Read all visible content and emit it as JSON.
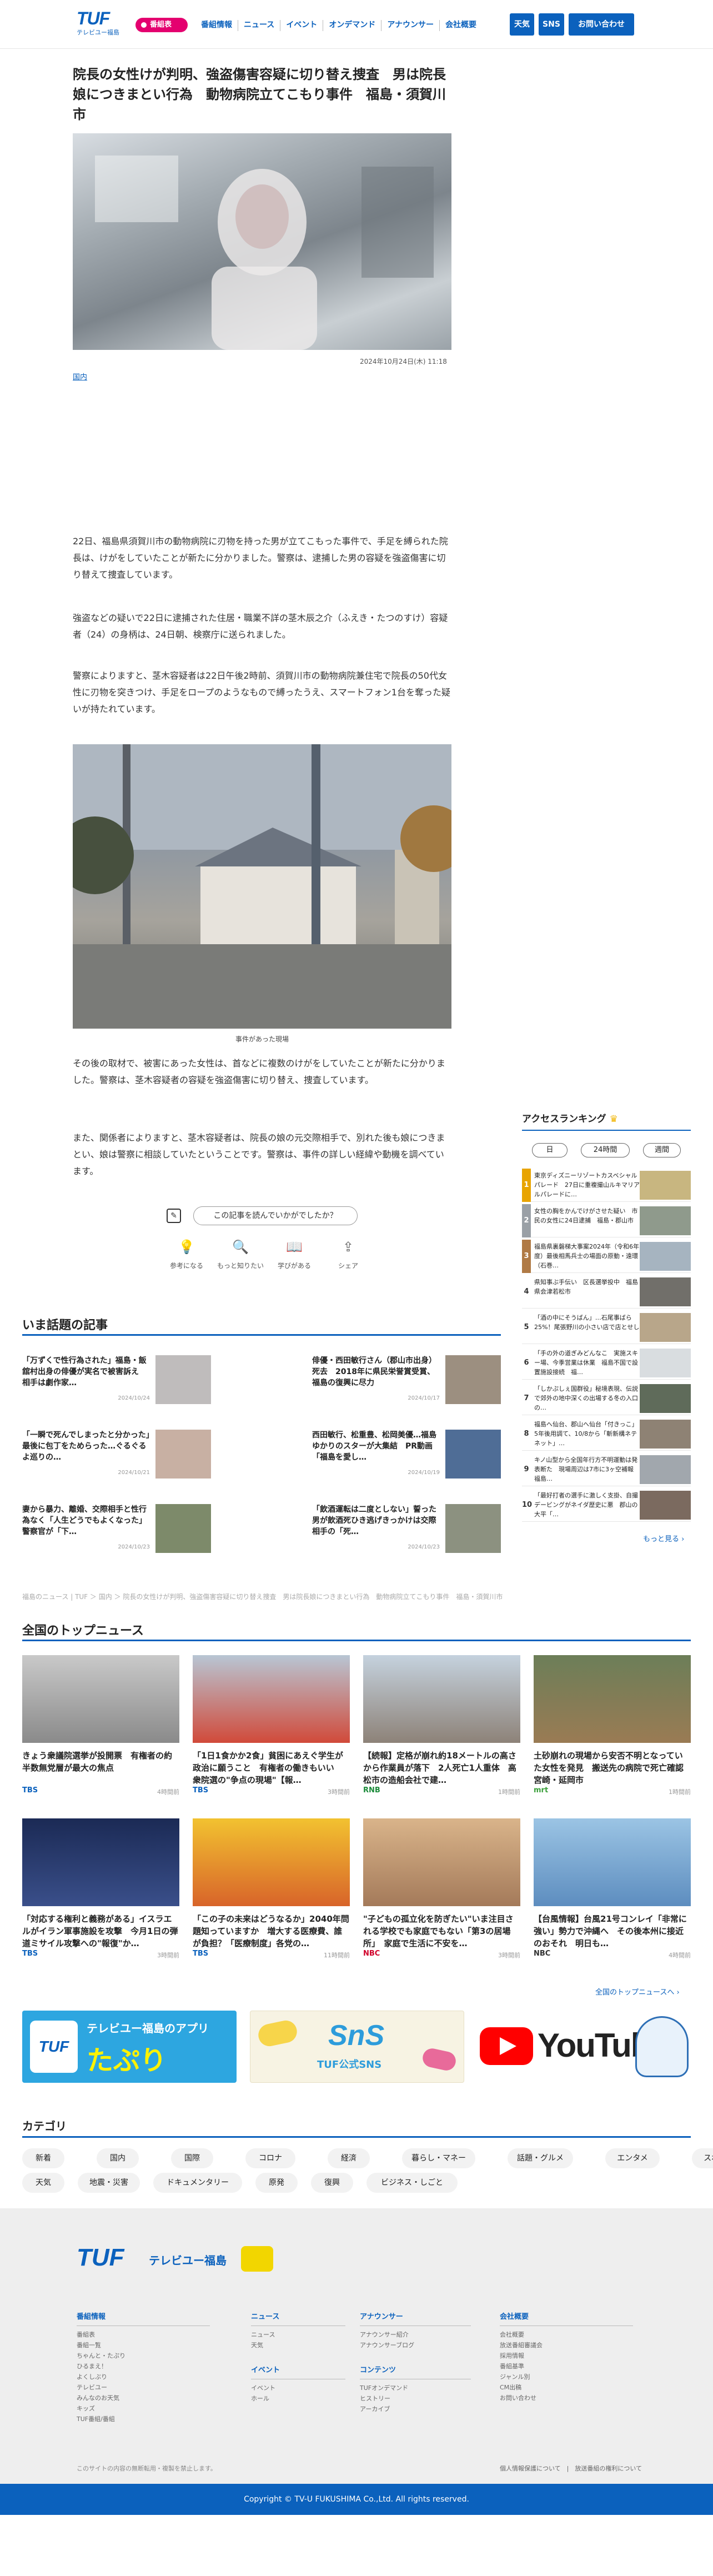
{
  "header": {
    "logo_text": "TUF",
    "logo_sub": "テレビユー福島",
    "bangumi_label": "番組表",
    "nav": [
      "番組情報",
      "ニュース",
      "イベント",
      "オンデマンド",
      "アナウンサー",
      "会社概要"
    ],
    "weather_label": "天気",
    "sns_label": "SNS",
    "contact_label": "お問い合わせ"
  },
  "article": {
    "title": "院長の女性けが判明、強盗傷害容疑に切り替え捜査　男は院長娘につきまとい行為　動物病院立てこもり事件　福島・須賀川市",
    "date": "2024年10月24日(木) 11:18",
    "category": "国内",
    "paragraphs": [
      "22日、福島県須賀川市の動物病院に刃物を持った男が立てこもった事件で、手足を縛られた院長は、けがをしていたことが新たに分かりました。警察は、逮捕した男の容疑を強盗傷害に切り替えて捜査しています。",
      "強盗などの疑いで22日に逮捕された住居・職業不詳の茎木辰之介（ふえき・たつのすけ）容疑者（24）の身柄は、24日朝、検察庁に送られました。",
      "警察によりますと、茎木容疑者は22日午後2時前、須賀川市の動物病院兼住宅で院長の50代女性に刃物を突きつけ、手足をロープのようなもので縛ったうえ、スマートフォン1台を奪った疑いが持たれています。",
      "その後の取材で、被害にあった女性は、首などに複数のけがをしていたことが新たに分かりました。警察は、茎木容疑者の容疑を強盗傷害に切り替え、捜査しています。",
      "また、関係者によりますと、茎木容疑者は、院長の娘の元交際相手で、別れた後も娘につきまとい、娘は警察に相談していたということです。警察は、事件の詳しい経緯や動機を調べています。"
    ],
    "photo_caption": "事件があった現場",
    "ask_label": "この記事を読んでいかがでしたか？",
    "reactions": [
      "参考になる",
      "もっと知りたい",
      "学びがある",
      "シェア"
    ]
  },
  "topics": {
    "title": "いま話題の記事",
    "items": [
      {
        "title": "「万ずくで性行為された」福島・飯舘村出身の俳優が実名で被害訴え　相手は劇作家…",
        "date": "2024/10/24"
      },
      {
        "title": "俳優・西田敏行さん（郡山市出身）死去　2018年に県民栄誉賞受賞、福島の復興に尽力",
        "date": "2024/10/17"
      },
      {
        "title": "「一瞬で死んでしまったと分かった」最後に包丁をためらった…ぐるぐるよ巡りの…",
        "date": "2024/10/21"
      },
      {
        "title": "西田敏行、松重豊、松岡美優…福島ゆかりのスターが大集結　PR動画「福島を愛し…",
        "date": "2024/10/19"
      },
      {
        "title": "妻から暴力、離婚、交際相手と性行為なく「人生どうでもよくなった」警察官が「下…",
        "date": "2024/10/23"
      },
      {
        "title": "「飲酒運転は二度としない」誓った男が飲酒死ひき逃げきっかけは交際相手の「死…",
        "date": "2024/10/23"
      }
    ]
  },
  "ranking": {
    "title": "アクセスランキング",
    "tabs": [
      "日",
      "24時間",
      "週間"
    ],
    "items": [
      {
        "num": "1",
        "title": "東京ディズニーリゾートカスベシャルパレード　27日に重複撮山ルキマリアルパレードに…"
      },
      {
        "num": "2",
        "title": "女性の胸をかんでけがさせた疑い　市民の女性に24日逮捕　福島・郡山市"
      },
      {
        "num": "3",
        "title": "福島県裏磐梯大事案2024年（令和6年度）最後相馬兵士の場面の原動・遠環（石巻…"
      },
      {
        "num": "4",
        "title": "県知事ぶ手伝い　区長選挙投中　福島県会津若松市"
      },
      {
        "num": "5",
        "title": "「酒の中にそうばん」…石尾事ばら25%！尾張野川の小さい店で店とせし"
      },
      {
        "num": "6",
        "title": "「手の外の道ぎみどんなこ　実施スキー場、今季営業は休業　福島不国で設置施設接続　福…"
      },
      {
        "num": "7",
        "title": "「しかぷしぇ国群役」秘境表現、伝説で郊外の地中深くの出場する冬の入口の…"
      },
      {
        "num": "8",
        "title": "福島へ仙台、郡山へ仙台「付きっこ」5年後用調て、10/8から「斬新構ネテネット」…"
      },
      {
        "num": "9",
        "title": "キノ山型から全国年行方不明運動は発表断た　現場周辺は7市に3ヶ空補報　福島…"
      },
      {
        "num": "10",
        "title": "「最好打者の選手に激しく支掛、自撮デービングがネイダ歴史に悪　郡山の大平「…"
      }
    ],
    "more_label": "もっと見る"
  },
  "breadcrumb": "福島のニュース | TUF ＞ 国内 ＞ 院長の女性けが判明、強盗傷害容疑に切り替え捜査　男は院長娘につきまとい行為　動物病院立てこもり事件　福島・須賀川市",
  "top_news": {
    "title": "全国のトップニュース",
    "items": [
      {
        "title": "きょう衆議院選挙が投開票　有権者の約半数無党層が最大の焦点",
        "source": "TBS",
        "time": "4時間前"
      },
      {
        "title": "「1日1食かか2食」貧困にあえぐ学生が政治に願うこと　有権者の働きもいい　衆院選の\"争点の現場\"【報…",
        "source": "TBS",
        "time": "3時間前"
      },
      {
        "title": "【続報】定格が崩れ約18メートルの高さから作業員が落下　2人死亡1人重体　高松市の造船会社で建…",
        "source": "RNB",
        "time": "1時間前"
      },
      {
        "title": "土砂崩れの現場から安否不明となっていた女性を発見　搬送先の病院で死亡確認　宮崎・延岡市",
        "source": "mrt",
        "time": "1時間前"
      },
      {
        "title": "「対応する権利と義務がある」イスラエルがイラン軍事施設を攻撃　今月1日の弾道ミサイル攻撃への\"報復\"か…",
        "source": "TBS",
        "time": "3時間前"
      },
      {
        "title": "「この子の未来はどうなるか」2040年問題知っていますか　増大する医療費、誰が負担？「医療制度」各党の…",
        "source": "TBS",
        "time": "11時間前"
      },
      {
        "title": "\"子どもの孤立化を防ぎたい\"いま注目される学校でも家庭でもない「第3の居場所」　家庭で生活に不安を…",
        "source": "NBC",
        "time": "3時間前"
      },
      {
        "title": "【台風情報】台風21号コンレイ「非常に強い」勢力で沖縄へ　その後本州に接近のおそれ　明日も…",
        "source": "NBC",
        "time": "4時間前"
      }
    ],
    "more_label": "全国のトップニュースへ"
  },
  "banners": {
    "app_title": "テレビユー福島のアプリ",
    "app_name": "たぷり",
    "sns_title": "SnS",
    "sns_sub": "TUF公式SNS",
    "youtube": "YouTube"
  },
  "categories": {
    "title": "カテゴリ",
    "items": [
      "新着",
      "国内",
      "国際",
      "コロナ",
      "経済",
      "暮らし・マネー",
      "話題・グルメ",
      "エンタメ",
      "スポーツ",
      "天気",
      "地震・災害",
      "ドキュメンタリー",
      "原発",
      "復興",
      "ビジネス・しごと"
    ]
  },
  "footer": {
    "logo_text": "TUF",
    "logo_sub": "テレビユー福島",
    "col1_title": "番組情報",
    "col1_items": [
      "番組表",
      "番組一覧",
      "ちゃんと・たぷり",
      "ひるまえ！",
      "よくしぶり",
      "テレビユー",
      "みんなのお天気",
      "キッズ",
      "TUF番組/番組"
    ],
    "col2_title": "ニュース",
    "col2_items": [
      "ニュース",
      "天気"
    ],
    "col2b_title": "イベント",
    "col2b_items": [
      "イベント",
      "ホール"
    ],
    "col3_title": "アナウンサー",
    "col3_items": [
      "アナウンサー紹介",
      "アナウンサーブログ"
    ],
    "col3b_title": "コンテンツ",
    "col3b_items": [
      "TUFオンデマンド",
      "ヒストリー",
      "アーカイブ"
    ],
    "col4_title": "会社概要",
    "col4_items": [
      "会社概要",
      "放送番組審議会",
      "採用情報",
      "番組基準",
      "ジャンル別",
      "CM出稿",
      "お問い合わせ"
    ],
    "note": "このサイトの内容の無断転用・複製を禁止します。",
    "links": "個人情報保護について　|　放送番組の権利について",
    "copyright": "Copyright © TV-U FUKUSHIMA Co.,Ltd. All rights reserved."
  }
}
